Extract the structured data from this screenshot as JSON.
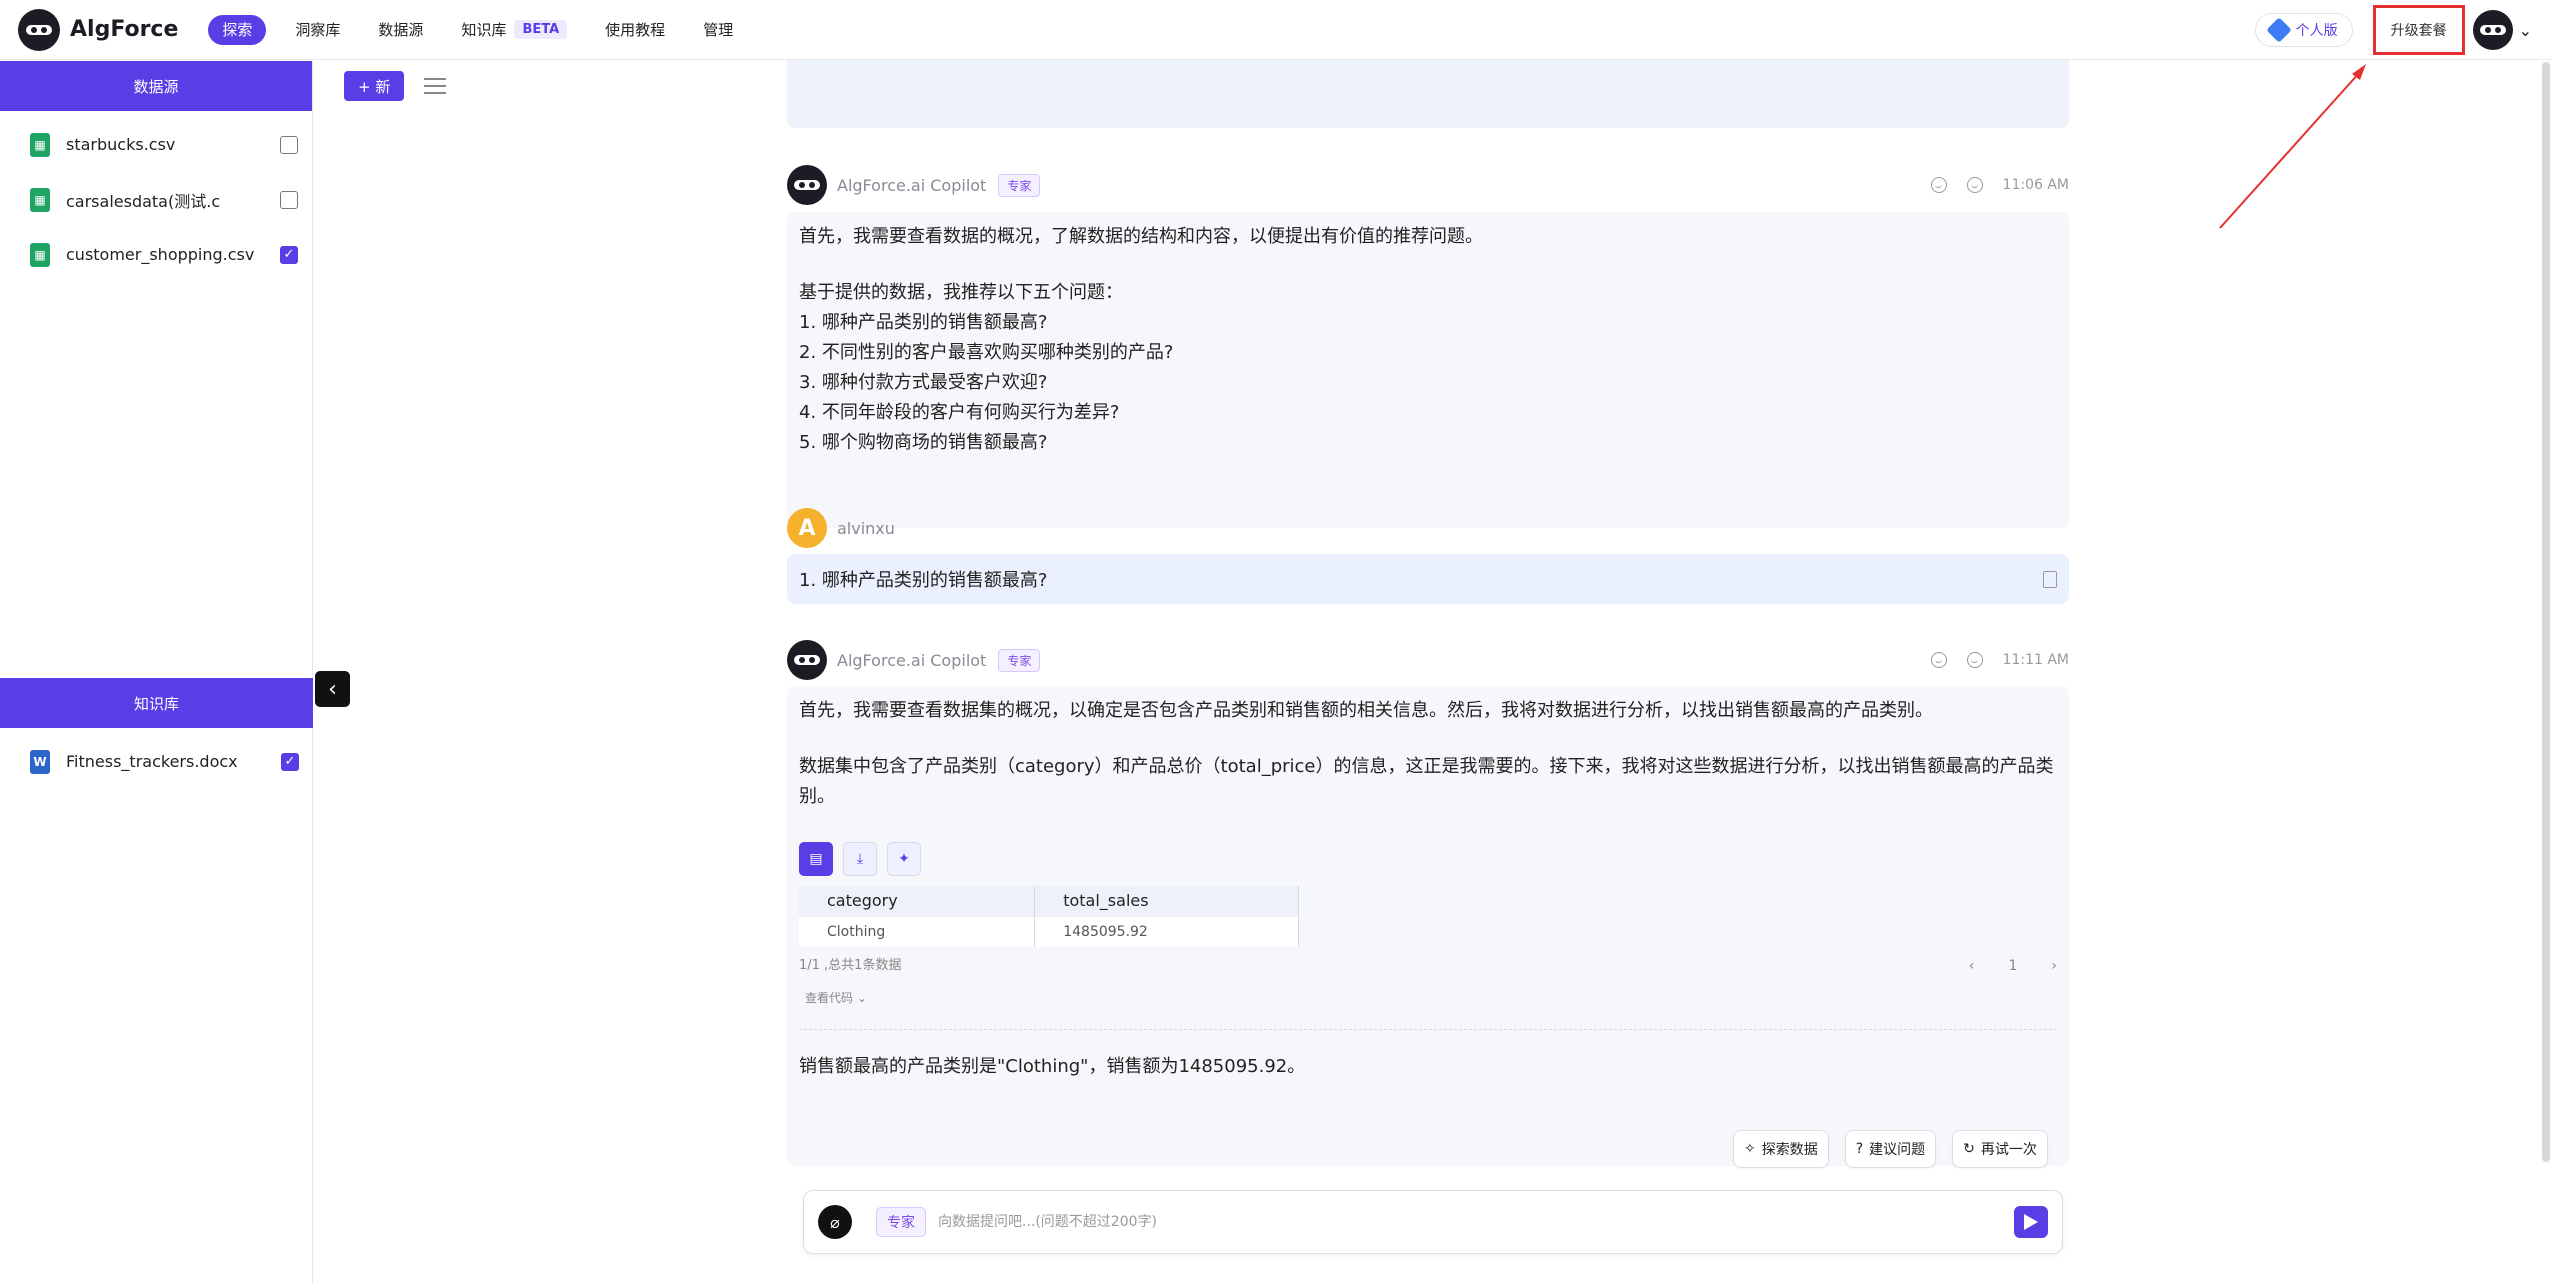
{
  "app": {
    "name": "AlgForce"
  },
  "nav": {
    "items": [
      {
        "label": "探索",
        "active": true
      },
      {
        "label": "洞察库",
        "active": false
      },
      {
        "label": "数据源",
        "active": false
      },
      {
        "label": "知识库",
        "active": false,
        "badge": "BETA"
      },
      {
        "label": "使用教程",
        "active": false
      },
      {
        "label": "管理",
        "active": false
      }
    ],
    "plan_label": "个人版",
    "upgrade_label": "升级套餐"
  },
  "sidebar": {
    "datasource_title": "数据源",
    "files": [
      {
        "name": "starbucks.csv",
        "checked": false
      },
      {
        "name": "carsalesdata(测试.c",
        "checked": false
      },
      {
        "name": "customer_shopping.csv",
        "checked": true
      }
    ],
    "kb_title": "知识库",
    "kb_files": [
      {
        "name": "Fitness_trackers.docx",
        "checked": true
      }
    ]
  },
  "toolbar": {
    "new_label": "+ 新"
  },
  "chat": {
    "msg1": {
      "sender": "AlgForce.ai Copilot",
      "tag": "专家",
      "time": "11:06 AM",
      "intro": "首先，我需要查看数据的概况，了解数据的结构和内容，以便提出有价值的推荐问题。",
      "lead": "基于提供的数据，我推荐以下五个问题：",
      "questions": [
        "1. 哪种产品类别的销售额最高?",
        "2. 不同性别的客户最喜欢购买哪种类别的产品?",
        "3. 哪种付款方式最受客户欢迎?",
        "4. 不同年龄段的客户有何购买行为差异?",
        "5. 哪个购物商场的销售额最高?"
      ]
    },
    "user_msg": {
      "sender": "alvinxu",
      "avatar_letter": "A",
      "text": "1. 哪种产品类别的销售额最高?"
    },
    "msg2": {
      "sender": "AlgForce.ai Copilot",
      "tag": "专家",
      "time": "11:11 AM",
      "p1": "首先，我需要查看数据集的概况，以确定是否包含产品类别和销售额的相关信息。然后，我将对数据进行分析，以找出销售额最高的产品类别。",
      "p2": "数据集中包含了产品类别（category）和产品总价（total_price）的信息，这正是我需要的。接下来，我将对这些数据进行分析，以找出销售额最高的产品类别。",
      "table": {
        "headers": [
          "category",
          "total_sales"
        ],
        "rows": [
          [
            "Clothing",
            "1485095.92"
          ]
        ]
      },
      "table_footer": "1/1 ,总共1条数据",
      "page": "1",
      "code_toggle": "查看代码 ⌄",
      "conclusion": "销售额最高的产品类别是\"Clothing\"，销售额为1485095.92。"
    },
    "actions": [
      {
        "label": "探索数据",
        "icon": "sparkle-icon"
      },
      {
        "label": "建议问题",
        "icon": "question-icon"
      },
      {
        "label": "再试一次",
        "icon": "refresh-icon"
      }
    ],
    "input": {
      "tag": "专家",
      "placeholder": "向数据提问吧...(问题不超过200字)"
    }
  },
  "colors": {
    "accent": "#5b3de6",
    "annotation": "#e53030"
  }
}
